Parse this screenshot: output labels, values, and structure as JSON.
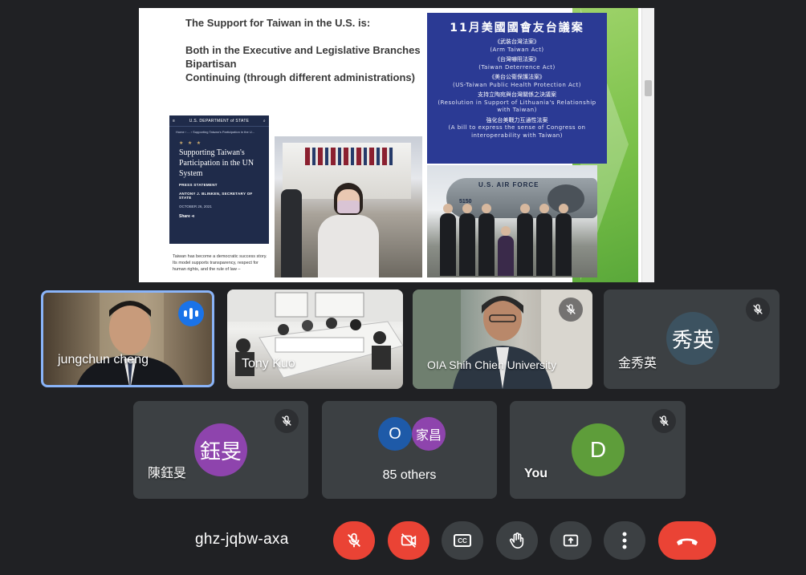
{
  "slide": {
    "heading": "The Support for Taiwan in the U.S. is:",
    "points": [
      "Both in the Executive and Legislative Branches",
      "Bipartisan",
      "Continuing (through different administrations)"
    ],
    "state_dept": {
      "header": "U.S. DEPARTMENT of STATE",
      "breadcrumb": "Home › ... › Supporting Taiwan's Participation in the U...",
      "stars": "★ ★ ★",
      "title": "Supporting Taiwan's Participation in the UN System",
      "type": "PRESS STATEMENT",
      "author": "ANTONY J. BLINKEN, SECRETARY OF STATE",
      "date": "OCTOBER 26, 2021",
      "share": "Share",
      "body": "Taiwan has become a democratic success story. Its model supports transparency, respect for human rights, and the rule of law –"
    },
    "bills": {
      "title": "11月美國國會友台議案",
      "items": [
        {
          "zh": "《武裝台灣法案》",
          "en": "(Arm Taiwan Act)"
        },
        {
          "zh": "《台灣嚇阻法案》",
          "en": "(Taiwan Deterrence Act)"
        },
        {
          "zh": "《美台公衛保護法案》",
          "en": "(US-Taiwan Public Health Protection Act)"
        },
        {
          "zh": "支持立陶宛與台灣關係之決議案",
          "en": "(Resolution in Support of Lithuania's Relationship with Taiwan)"
        },
        {
          "zh": "強化台美戰力互通性法案",
          "en": "(A bill to express the sense of Congress on interoperability with Taiwan)"
        }
      ]
    },
    "plane_text": "U.S. AIR FORCE",
    "plane_number": "5150"
  },
  "participants": {
    "jungchun": {
      "name": "jungchun cheng"
    },
    "tony": {
      "name": "Tony Kuo"
    },
    "shih": {
      "name": "OIA Shih Chien University"
    },
    "kim": {
      "name": "金秀英",
      "initials": "秀英",
      "color": "#3c5260"
    },
    "chen": {
      "name": "陳鈺旻",
      "initials": "鈺旻",
      "color": "#8e44ad"
    },
    "others": {
      "label": "85 others",
      "avatar1": "O",
      "avatar1_color": "#1e5aa8",
      "avatar2": "家昌",
      "avatar2_color": "#8e44ad"
    },
    "you": {
      "name": "You",
      "initials": "D",
      "color": "#5e9d3a"
    }
  },
  "controls": {
    "meeting_code": "ghz-jqbw-axa",
    "buttons": [
      "mic-off",
      "camera-off",
      "captions",
      "raise-hand",
      "present",
      "more-options",
      "leave-call"
    ],
    "cc_label": "CC"
  }
}
